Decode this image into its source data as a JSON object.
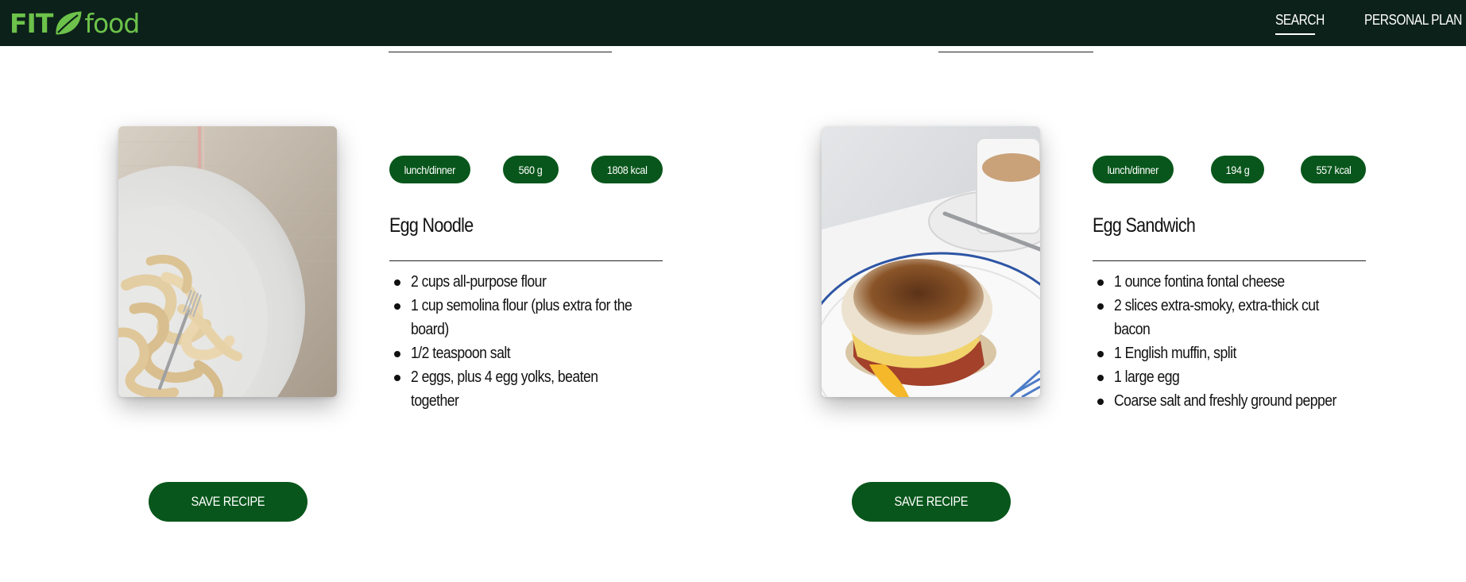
{
  "header": {
    "logo_fit": "FIT",
    "logo_food": "food",
    "nav": [
      {
        "label": "SEARCH",
        "active": true
      },
      {
        "label": "PERSONAL PLAN",
        "active": false
      }
    ]
  },
  "colors": {
    "navbar_bg": "#0c2119",
    "accent_green": "#08561b",
    "logo_green": "#6cc24a"
  },
  "recipes": [
    {
      "badges": [
        "lunch/dinner",
        "560 g",
        "1808 kcal"
      ],
      "title": "Egg Noodle",
      "ingredients": [
        "2 cups all-purpose flour",
        "1 cup semolina flour (plus extra for the board)",
        "1/2 teaspoon salt",
        "2 eggs, plus 4 egg yolks, beaten together"
      ],
      "save_label": "SAVE RECIPE"
    },
    {
      "badges": [
        "lunch/dinner",
        "194 g",
        "557 kcal"
      ],
      "title": "Egg Sandwich",
      "ingredients": [
        "1 ounce fontina fontal cheese",
        "2 slices extra-smoky, extra-thick cut bacon",
        "1 English muffin, split",
        "1 large egg",
        "Coarse salt and freshly ground pepper"
      ],
      "save_label": "SAVE RECIPE"
    }
  ]
}
